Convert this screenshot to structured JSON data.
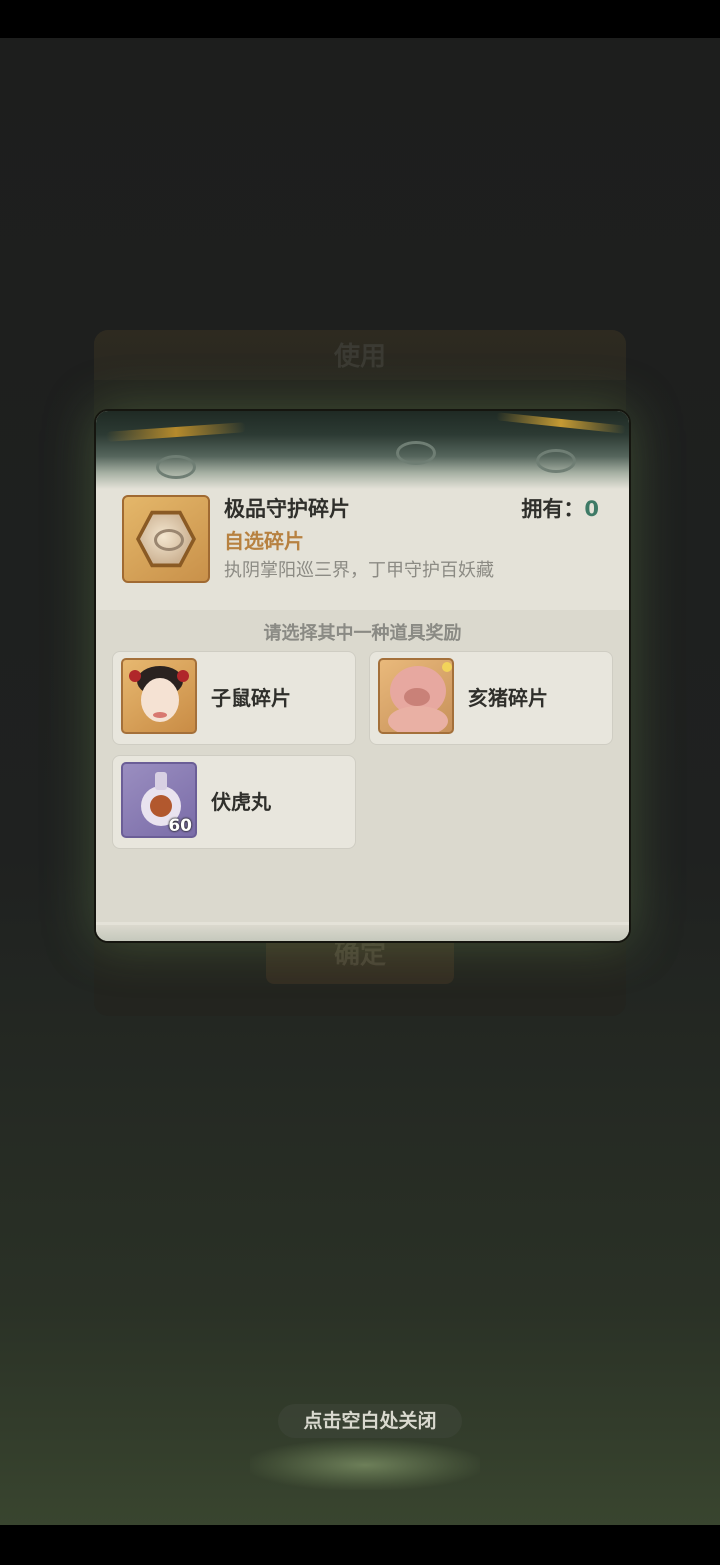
{
  "background": {
    "title": "使用",
    "confirm_label": "确定"
  },
  "dialog": {
    "item": {
      "name": "极品守护碎片",
      "subtitle": "自选碎片",
      "description": "执阴掌阳巡三界，丁甲守护百妖藏",
      "owned_label": "拥有：",
      "owned_value": "0"
    },
    "choose_title": "请选择其中一种道具奖励",
    "options": [
      {
        "label": "子鼠碎片",
        "icon": "rat-character-icon"
      },
      {
        "label": "亥猪碎片",
        "icon": "pig-character-icon"
      },
      {
        "label": "伏虎丸",
        "icon": "potion-bottle-icon",
        "quantity": "60"
      }
    ]
  },
  "close_hint": "点击空白处关闭",
  "colors": {
    "owned_value": "#3e7a66",
    "subtitle": "#b78140",
    "dialog_bg": "#e4e2d8"
  }
}
